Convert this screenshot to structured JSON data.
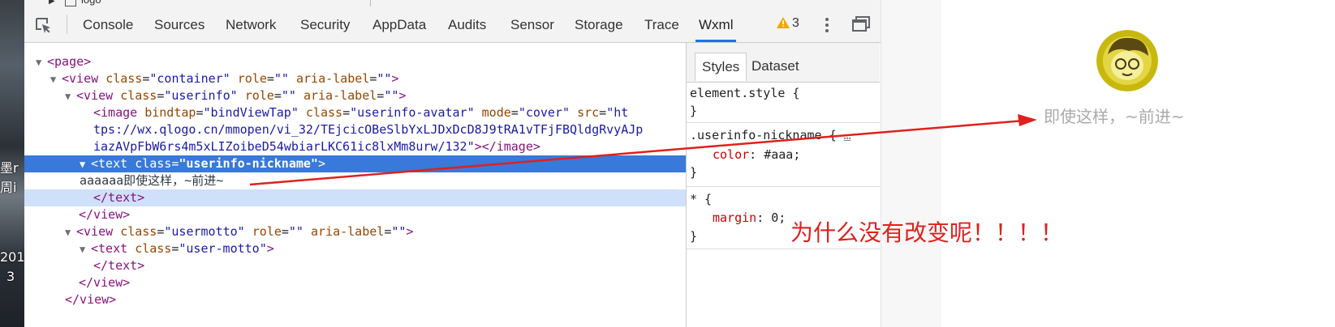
{
  "desktop": {
    "fragments": [
      "墨r",
      "周i",
      "201",
      "3"
    ]
  },
  "topbar": {
    "node_label": "logo"
  },
  "toolbar": {
    "tabs": [
      "Console",
      "Sources",
      "Network",
      "Security",
      "AppData",
      "Audits",
      "Sensor",
      "Storage",
      "Trace",
      "Wxml"
    ],
    "active_tab": "Wxml",
    "warning_count": "3",
    "accent_color": "#1a73e8"
  },
  "elements": {
    "l1_tag": "<page>",
    "l2_open": "<view",
    "l2_a1": "class",
    "l2_v1": "\"container\"",
    "l2_a2": "role",
    "l2_v2": "\"\"",
    "l2_a3": "aria-label",
    "l2_v3": "\"\"",
    "l2_close": ">",
    "l3_open": "<view",
    "l3_a1": "class",
    "l3_v1": "\"userinfo\"",
    "l3_a2": "role",
    "l3_v2": "\"\"",
    "l3_a3": "aria-label",
    "l3_v3": "\"\"",
    "l3_close": ">",
    "l4_open": "<image",
    "l4_a1": "bindtap",
    "l4_v1": "\"bindViewTap\"",
    "l4_a2": "class",
    "l4_v2": "\"userinfo-avatar\"",
    "l4_a3": "mode",
    "l4_v3": "\"cover\"",
    "l4_a4": "src",
    "l4_v4a": "\"ht",
    "l5_text": "tps://wx.qlogo.cn/mmopen/vi_32/TEjcicOBeSlbYxLJDxDcD8J9tRA1vTFjFBQldgRvyAJp",
    "l6_text": "iazAVpFbW6rs4m5xLIZoibeD54wbiarLKC61ic8lxMm8urw/132\"",
    "l6_close": "></image>",
    "l7_open": "<text",
    "l7_a1": "class",
    "l7_v1": "\"userinfo-nickname\"",
    "l7_close": ">",
    "l8_text": "aaaaaa即使这样，~前进~",
    "l9_close": "</text>",
    "l10_close": "</view>",
    "l11_open": "<view",
    "l11_a1": "class",
    "l11_v1": "\"usermotto\"",
    "l11_a2": "role",
    "l11_v2": "\"\"",
    "l11_a3": "aria-label",
    "l11_v3": "\"\"",
    "l11_close": ">",
    "l12_open": "<text",
    "l12_a1": "class",
    "l12_v1": "\"user-motto\"",
    "l12_close": ">",
    "l13_close": "</text>",
    "l14_close": "</view>",
    "l15_close": "</view>"
  },
  "styles": {
    "tabs": [
      "Styles",
      "Dataset"
    ],
    "active_tab": "Styles",
    "rule1_selector": "element.style {",
    "rule1_end": "}",
    "rule2_selector": ".userinfo-nickname {",
    "rule2_more": "…",
    "rule2_prop": "color",
    "rule2_val": "#aaa;",
    "rule2_end": "}",
    "rule3_selector": "* {",
    "rule3_prop": "margin",
    "rule3_val": "0;",
    "rule3_end": "}"
  },
  "preview": {
    "nickname": "即使这样，~前进~",
    "nickname_color": "#aaaaaa"
  },
  "annotation": {
    "text": "为什么没有改变呢！！！！",
    "color": "#e0201e"
  }
}
